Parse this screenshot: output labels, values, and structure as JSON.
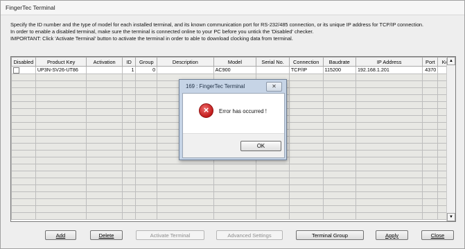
{
  "window": {
    "title": "FingerTec Terminal"
  },
  "info": {
    "line1": "Specify the ID number and the type of model for each installed terminal, and its known communication port for RS-232/485 connection, or its unique IP address for TCP/IP connection.",
    "line2": "In order to enable a disabled terminal, make sure the terminal is connected online to your PC before you untick the 'Disabled' checker.",
    "line3": "IMPORTANT: Click 'Activate Terminal' button to activate the terminal in order to able to download clocking data from terminal."
  },
  "grid": {
    "columns": [
      "Disabled",
      "Product Key",
      "Activation",
      "ID",
      "Group",
      "Description",
      "Model",
      "Serial No.",
      "Connection",
      "Baudrate",
      "IP Address",
      "Port",
      "Key"
    ],
    "rows": [
      {
        "disabled": false,
        "product_key": "UP3N-SV26-UT86",
        "activation": "",
        "id": "1",
        "group": "0",
        "description": "",
        "model": "AC900",
        "serial_no": "",
        "connection": "TCP/IP",
        "baudrate": "115200",
        "ip_address": "192.168.1.201",
        "port": "4370",
        "key": ""
      }
    ]
  },
  "buttons": {
    "add": "Add",
    "delete": "Delete",
    "activate": "Activate Terminal",
    "advanced": "Advanced Settings",
    "terminal_group": "Terminal Group",
    "apply": "Apply",
    "close": "Close"
  },
  "dialog": {
    "title": "169 : FingerTec Terminal",
    "close_glyph": "✕",
    "message": "Error has occurred !",
    "ok": "OK"
  }
}
